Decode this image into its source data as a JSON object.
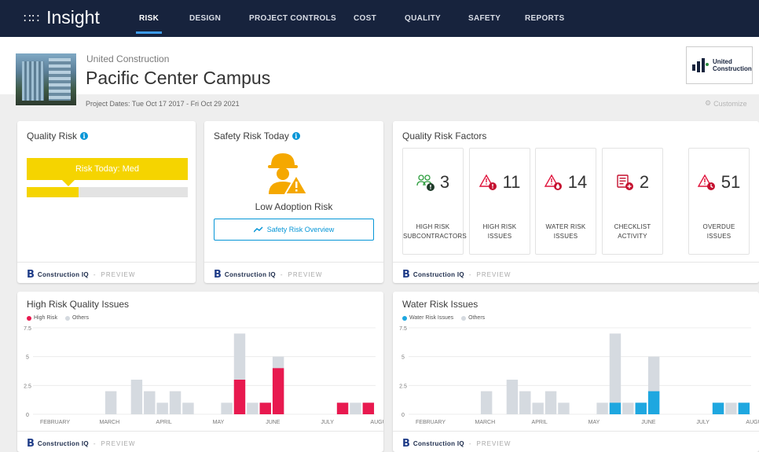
{
  "app": {
    "name": "Insight",
    "grid_icon": "grid-icon"
  },
  "nav": [
    "RISK",
    "DESIGN",
    "PROJECT CONTROLS",
    "COST",
    "QUALITY",
    "SAFETY",
    "REPORTS"
  ],
  "header": {
    "company": "United Construction",
    "project": "Pacific Center Campus",
    "dates": "Project Dates: Tue Oct 17 2017 - Fri Oct 29 2021",
    "customize": "Customize",
    "logo_text_1": "United",
    "logo_text_2": "Construction"
  },
  "footer": {
    "brand": "Construction IQ",
    "separator": "-",
    "preview": "PREVIEW"
  },
  "quality_risk": {
    "title": "Quality Risk",
    "band": "Risk Today: Med",
    "level_fraction": 0.32,
    "color": "#f5d400"
  },
  "safety_risk": {
    "title": "Safety Risk Today",
    "status": "Low Adoption Risk",
    "button": "Safety Risk Overview"
  },
  "factors": {
    "title": "Quality Risk Factors",
    "items": [
      {
        "value": "3",
        "label1": "HIGH RISK",
        "label2": "SUBCONTRACTORS",
        "icon": "subcontractor-icon"
      },
      {
        "value": "11",
        "label1": "HIGH RISK",
        "label2": "ISSUES",
        "icon": "warning-issue-icon"
      },
      {
        "value": "14",
        "label1": "WATER RISK",
        "label2": "ISSUES",
        "icon": "warning-water-icon"
      },
      {
        "value": "2",
        "label1": "CHECKLIST",
        "label2": "ACTIVITY",
        "icon": "checklist-icon"
      },
      {
        "value": "51",
        "label1": "OVERDUE",
        "label2": "ISSUES",
        "icon": "warning-clock-icon"
      }
    ]
  },
  "chart_data": [
    {
      "type": "bar",
      "title": "High Risk Quality Issues",
      "legend": [
        "High Risk",
        "Others"
      ],
      "colors": {
        "primary": "#e8194f",
        "others": "#d5dae0"
      },
      "yticks": [
        "7.5",
        "5",
        "2.5",
        "0"
      ],
      "ylim": [
        0,
        7.5
      ],
      "xlabels": [
        "FEBRUARY",
        "MARCH",
        "APRIL",
        "MAY",
        "JUNE",
        "JULY",
        "AUGUST"
      ],
      "series": [
        {
          "name": "High Risk",
          "values": [
            0,
            0,
            0,
            0,
            0,
            0,
            0,
            0,
            0,
            0,
            0,
            0,
            0,
            0,
            0,
            3,
            0,
            1,
            4,
            0,
            0,
            0,
            0,
            1,
            0,
            1
          ]
        },
        {
          "name": "Others",
          "values": [
            0,
            0,
            0,
            0,
            0,
            2,
            0,
            3,
            2,
            1,
            2,
            1,
            0,
            0,
            1,
            7,
            1,
            1,
            5,
            0,
            0,
            0,
            0,
            1,
            1,
            1
          ]
        }
      ]
    },
    {
      "type": "bar",
      "title": "Water Risk Issues",
      "legend": [
        "Water Risk Issues",
        "Others"
      ],
      "colors": {
        "primary": "#1ea7e0",
        "others": "#d5dae0"
      },
      "yticks": [
        "7.5",
        "5",
        "2.5",
        "0"
      ],
      "ylim": [
        0,
        7.5
      ],
      "xlabels": [
        "FEBRUARY",
        "MARCH",
        "APRIL",
        "MAY",
        "JUNE",
        "JULY",
        "AUGUST"
      ],
      "series": [
        {
          "name": "Water Risk Issues",
          "values": [
            0,
            0,
            0,
            0,
            0,
            0,
            0,
            0,
            0,
            0,
            0,
            0,
            0,
            0,
            0,
            1,
            0,
            1,
            2,
            0,
            0,
            0,
            0,
            1,
            0,
            1
          ]
        },
        {
          "name": "Others",
          "values": [
            0,
            0,
            0,
            0,
            0,
            2,
            0,
            3,
            2,
            1,
            2,
            1,
            0,
            0,
            1,
            7,
            1,
            1,
            5,
            0,
            0,
            0,
            0,
            1,
            1,
            1
          ]
        }
      ]
    }
  ]
}
